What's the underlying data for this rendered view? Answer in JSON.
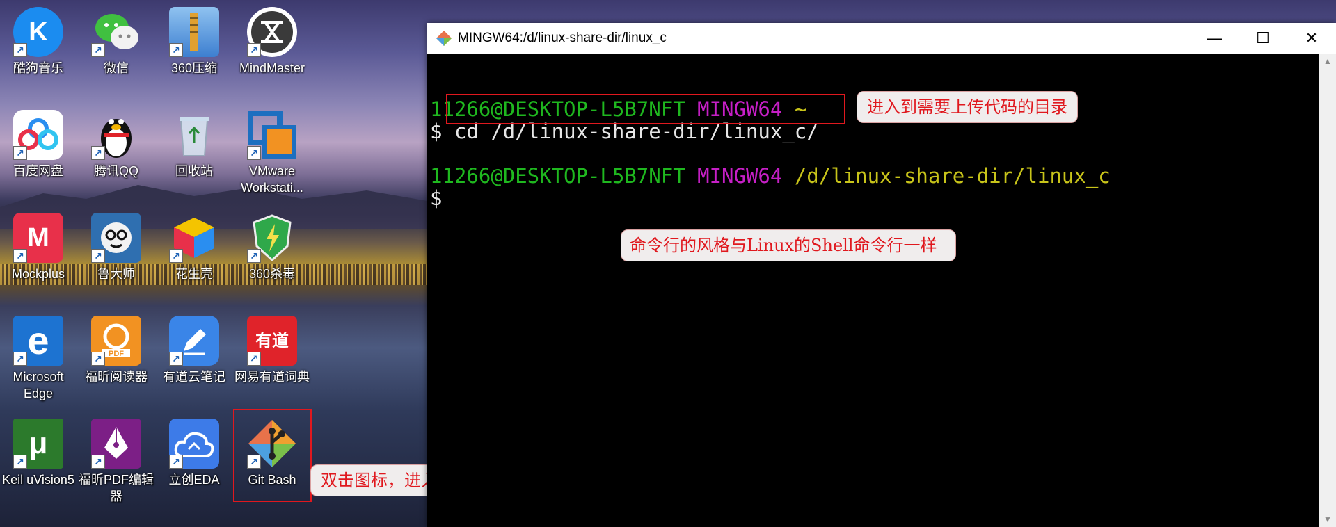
{
  "desktop": {
    "icons": [
      {
        "label": "酷狗音乐",
        "glyph": "K",
        "bg": "#1b8cf0"
      },
      {
        "label": "微信",
        "glyph": "",
        "bg": "transparent"
      },
      {
        "label": "360压缩",
        "glyph": "",
        "bg": "#3d7fd0"
      },
      {
        "label": "MindMaster",
        "glyph": "",
        "bg": "#ffffff"
      },
      {
        "label": "百度网盘",
        "glyph": "",
        "bg": "#ffffff"
      },
      {
        "label": "腾讯QQ",
        "glyph": "",
        "bg": "transparent"
      },
      {
        "label": "回收站",
        "glyph": "",
        "bg": "transparent"
      },
      {
        "label": "VMware Workstati...",
        "glyph": "",
        "bg": "transparent"
      },
      {
        "label": "Mockplus",
        "glyph": "M",
        "bg": "#e8304a"
      },
      {
        "label": "鲁大师",
        "glyph": "",
        "bg": "#2f6fb0"
      },
      {
        "label": "花生壳",
        "glyph": "",
        "bg": "transparent"
      },
      {
        "label": "360杀毒",
        "glyph": "",
        "bg": "transparent"
      },
      {
        "label": "Microsoft Edge",
        "glyph": "e",
        "bg": "#1d73d1"
      },
      {
        "label": "福昕阅读器",
        "glyph": "",
        "bg": "#f29222"
      },
      {
        "label": "有道云笔记",
        "glyph": "",
        "bg": "#3a85e8"
      },
      {
        "label": "网易有道词典",
        "glyph": "有道",
        "bg": "#e0232a"
      },
      {
        "label": "Keil uVision5",
        "glyph": "μ",
        "bg": "#2c7a2c"
      },
      {
        "label": "福昕PDF编辑器",
        "glyph": "",
        "bg": "#7c1f86"
      },
      {
        "label": "立创EDA",
        "glyph": "",
        "bg": "#3d7be8"
      },
      {
        "label": "Git Bash",
        "glyph": "",
        "bg": "transparent"
      }
    ]
  },
  "callouts": {
    "git_bash": "双击图标，进入命令行终端",
    "cd_command": "进入到需要上传代码的目录",
    "shell_style": "命令行的风格与Linux的Shell命令行一样"
  },
  "window": {
    "title": "MINGW64:/d/linux-share-dir/linux_c",
    "controls": {
      "minimize": "—",
      "maximize": "☐",
      "close": "✕"
    }
  },
  "terminal": {
    "line1": {
      "user_host": "11266@DESKTOP-L5B7NFT",
      "env": "MINGW64",
      "path": "~"
    },
    "line2": {
      "prompt": "$",
      "command": "cd /d/linux-share-dir/linux_c/"
    },
    "line3": {
      "user_host": "11266@DESKTOP-L5B7NFT",
      "env": "MINGW64",
      "path": "/d/linux-share-dir/linux_c"
    },
    "line4": {
      "prompt": "$"
    }
  },
  "colors": {
    "highlight_red": "#e0181e",
    "terminal_green": "#1fb81f",
    "terminal_magenta": "#c61fc6",
    "terminal_yellow": "#c8c41a"
  }
}
